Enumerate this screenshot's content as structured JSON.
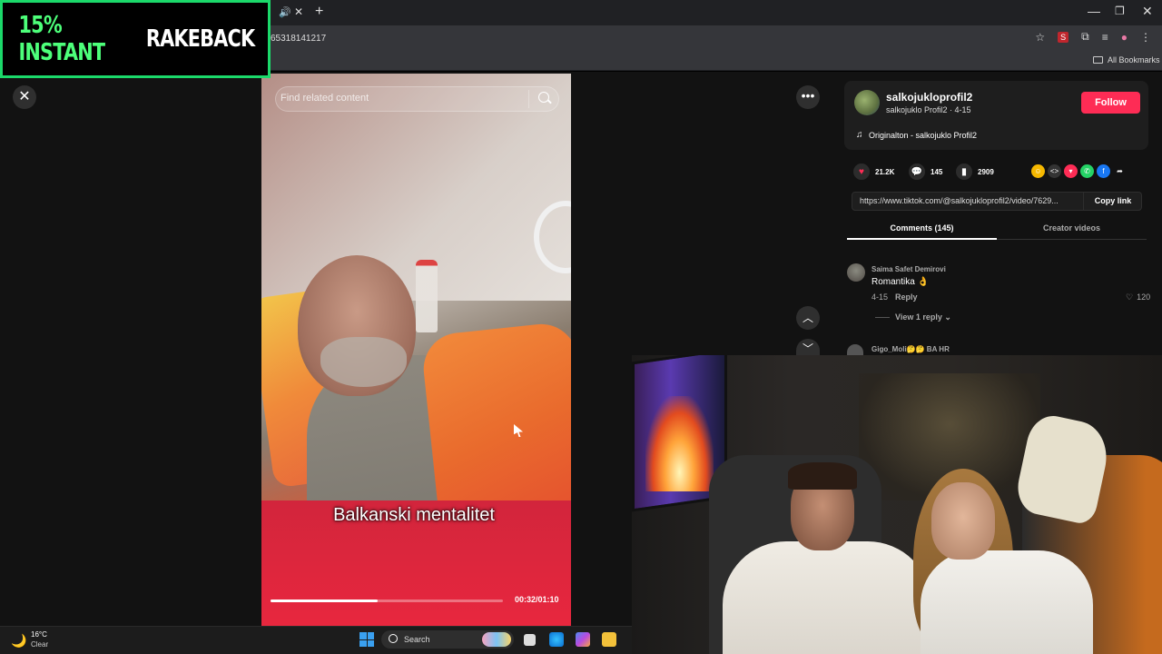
{
  "promo": {
    "highlight": "15% INSTANT",
    "rest": "RAKEBACK"
  },
  "browser": {
    "url": "65318141217",
    "bookmarks_label": "All Bookmarks"
  },
  "video": {
    "search_placeholder": "Find related content",
    "caption": "Balkanski mentalitet",
    "time": "00:32/01:10",
    "progress": 0.46
  },
  "post": {
    "username": "salkojukloprofil2",
    "subline": "salkojuklo Profil2 · 4-15",
    "follow_label": "Follow",
    "sound": "Originalton - salkojuklo Profil2",
    "likes": "21.2K",
    "comments": "145",
    "saves": "2909",
    "link": "https://www.tiktok.com/@salkojukloprofil2/video/7629...",
    "copy_label": "Copy link"
  },
  "tabs": {
    "comments": "Comments (145)",
    "creator": "Creator videos"
  },
  "comments": [
    {
      "author": "Saima Safet Demirovi",
      "text": "Romantika 👌",
      "date": "4-15",
      "reply": "Reply",
      "likes": "120",
      "view_replies": "View 1 reply"
    },
    {
      "author": "Gigo_Moli🤔🤔 BA HR"
    }
  ],
  "taskbar": {
    "temp": "16°C",
    "condition": "Clear",
    "search": "Search"
  },
  "colors": {
    "accent": "#fe2c55",
    "promo_green": "#1bd96a"
  }
}
